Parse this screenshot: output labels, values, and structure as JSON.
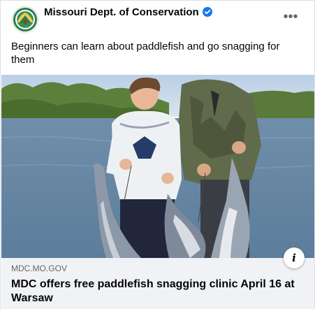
{
  "post": {
    "page_name": "Missouri Dept. of Conservation",
    "caption": "Beginners can learn about paddlefish and go snagging for them",
    "more_label": "•••",
    "verified_icon": "verified-badge-icon",
    "more_icon": "more-options-icon"
  },
  "link_preview": {
    "domain": "MDC.MO.GOV",
    "title": "MDC offers free paddlefish snagging clinic April 16 at Warsaw",
    "info_label": "i"
  },
  "colors": {
    "verified_blue": "#1877f2",
    "link_bar_bg": "#f0f2f5",
    "secondary_text": "#65676b"
  }
}
